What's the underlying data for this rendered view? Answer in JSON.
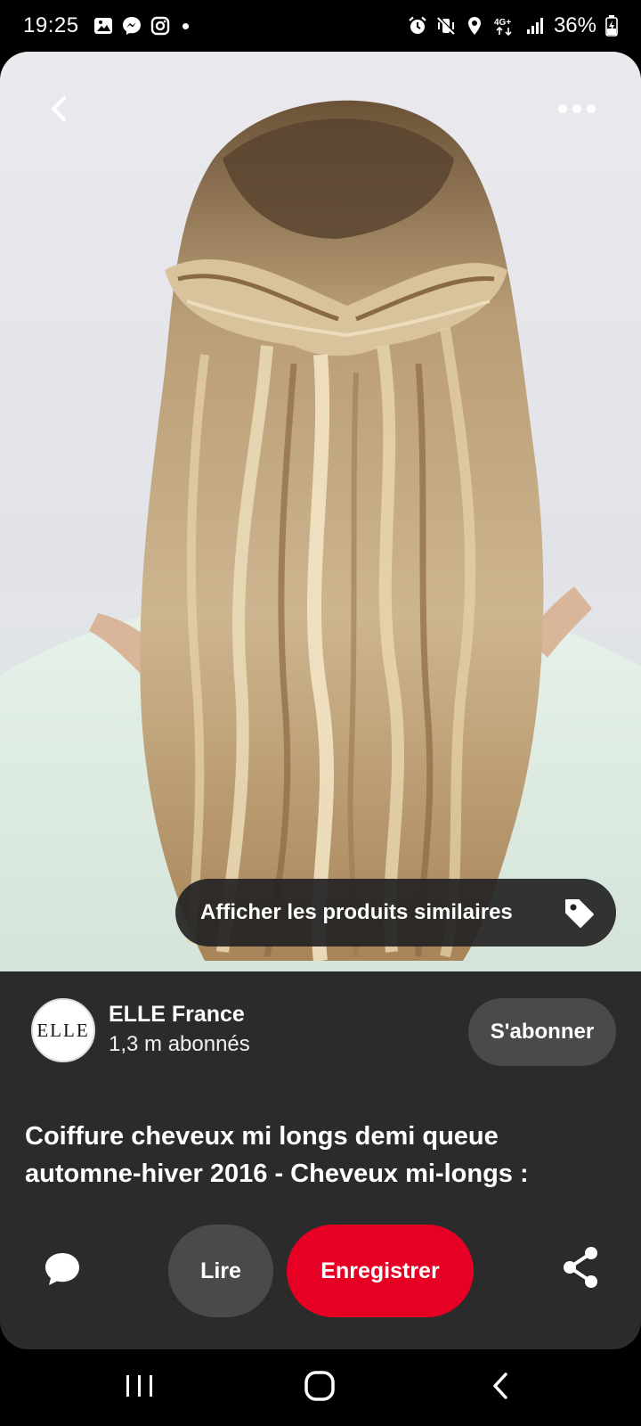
{
  "status_bar": {
    "time": "19:25",
    "battery": "36%",
    "network": "4G+",
    "left_icons": [
      "gallery-icon",
      "messenger-icon",
      "instagram-icon",
      "notification-dot"
    ],
    "right_icons": [
      "alarm-icon",
      "mute-vibrate-icon",
      "location-icon",
      "network-4g-icon",
      "signal-icon",
      "battery-charging-icon"
    ]
  },
  "pin": {
    "image_alt": "",
    "similar_products_label": "Afficher les produits similaires",
    "title": "Coiffure cheveux mi longs demi queue automne-hiver 2016 - Cheveux mi-longs :"
  },
  "creator": {
    "avatar_text": "ELLE",
    "name": "ELLE France",
    "followers": "1,3 m abonnés",
    "follow_label": "S'abonner"
  },
  "actions": {
    "read_label": "Lire",
    "save_label": "Enregistrer"
  },
  "colors": {
    "save_red": "#e60023",
    "panel_bg": "#2b2b2b",
    "secondary_button": "#4a4a4a"
  }
}
